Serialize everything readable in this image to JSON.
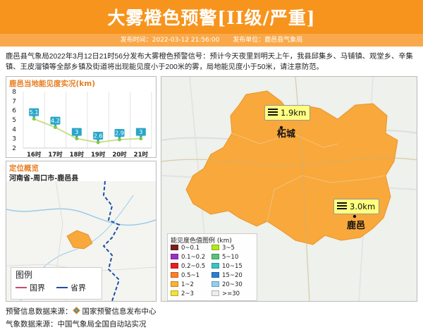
{
  "header": {
    "title": "大雾橙色预警[II级/严重]",
    "publish_time_label": "发布时间：2022-03-12 21:56:00",
    "publisher_label": "发布单位：鹿邑县气象局"
  },
  "description": "鹿邑县气象局2022年3月12日21时56分发布大雾橙色预警信号：预计今天夜里到明天上午，我县邱集乡、马铺镇、观堂乡、辛集镇、王皮溜镇等全部乡镇及街道将出现能见度小于200米的雾，局地能见度小于50米，请注意防范。",
  "chart": {
    "title": "鹿邑当地能见度实况(km)"
  },
  "chart_data": {
    "type": "line",
    "title": "鹿邑当地能见度实况(km)",
    "categories": [
      "16时",
      "17时",
      "18时",
      "19时",
      "20时",
      "21时"
    ],
    "values": [
      5.1,
      4.2,
      3,
      2.6,
      2.9,
      3
    ],
    "value_labels": [
      "5.1",
      "4.2",
      "3",
      "2.6",
      "2.9",
      "3"
    ],
    "yticks": [
      "2",
      "3",
      "4",
      "5",
      "6",
      "7",
      "8"
    ],
    "ylim": [
      2,
      8
    ],
    "grid": true,
    "line_color": "#c8e08a",
    "point_color": "#8dc63f",
    "label_color": "#2aa6c9"
  },
  "location": {
    "title": "定位概览",
    "path": "河南省-周口市-鹿邑县",
    "legend_title": "图例",
    "legend_national": "国界",
    "legend_provincial": "省界",
    "national_color": "#c94c6a",
    "provincial_color": "#1f4fa8"
  },
  "map": {
    "stations": [
      {
        "value": "1.9km",
        "city": "柘城"
      },
      {
        "value": "3.0km",
        "city": "鹿邑"
      }
    ],
    "fill_color": "#f9a83b",
    "callout_color": "#ffff80",
    "legend_title": "能见度色值图例 (km)",
    "legend": [
      {
        "label": "0~0.1",
        "color": "#7a1f1f"
      },
      {
        "label": "3~5",
        "color": "#b5e61d"
      },
      {
        "label": "0.1~0.2",
        "color": "#9b30c4"
      },
      {
        "label": "5~10",
        "color": "#56c47a"
      },
      {
        "label": "0.2~0.5",
        "color": "#e62020"
      },
      {
        "label": "10~15",
        "color": "#3ac4c4"
      },
      {
        "label": "0.5~1",
        "color": "#ff7f27"
      },
      {
        "label": "15~20",
        "color": "#2a7fd4"
      },
      {
        "label": "1~2",
        "color": "#fdb135"
      },
      {
        "label": "20~30",
        "color": "#8fd0f0"
      },
      {
        "label": "2~3",
        "color": "#f6e13a"
      },
      {
        "label": ">=30",
        "color": "#eeeeee"
      }
    ]
  },
  "footer": {
    "warning_source": "预警信息数据来源：",
    "warning_source_org": "国家预警信息发布中心",
    "weather_source": "气象数据来源：中国气象局全国自动站实况"
  }
}
